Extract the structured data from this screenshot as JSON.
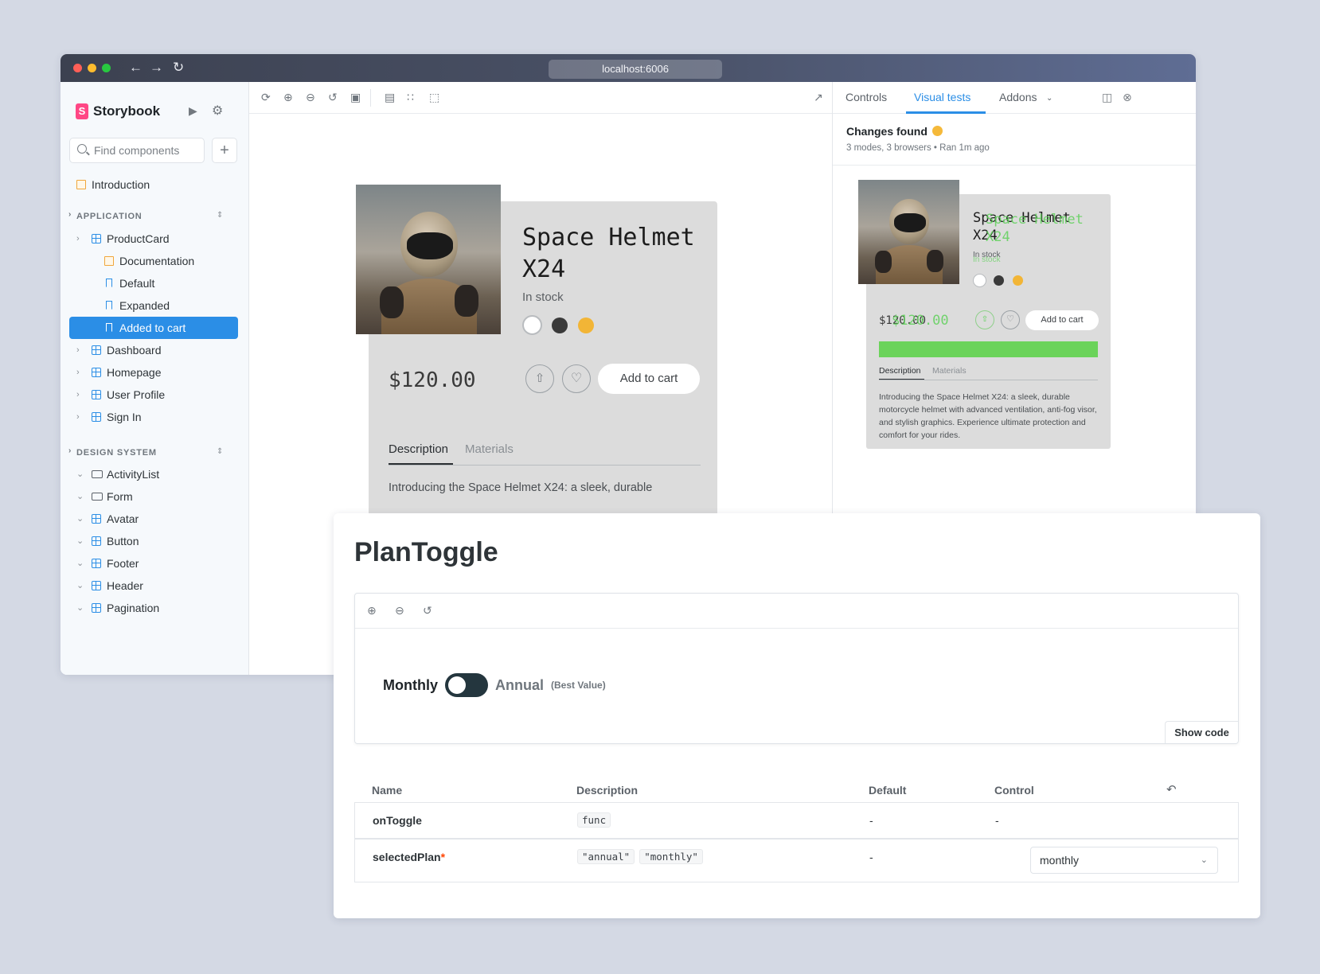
{
  "browser": {
    "url": "localhost:6006"
  },
  "sidebar": {
    "brand": "Storybook",
    "search_placeholder": "Find components",
    "intro": "Introduction",
    "sections": [
      {
        "label": "APPLICATION"
      },
      {
        "label": "DESIGN SYSTEM"
      }
    ],
    "app_items": [
      {
        "label": "ProductCard"
      },
      {
        "label": "Documentation"
      },
      {
        "label": "Default"
      },
      {
        "label": "Expanded"
      },
      {
        "label": "Added to cart"
      },
      {
        "label": "Dashboard"
      },
      {
        "label": "Homepage"
      },
      {
        "label": "User Profile"
      },
      {
        "label": "Sign In"
      }
    ],
    "ds_items": [
      {
        "label": "ActivityList"
      },
      {
        "label": "Form"
      },
      {
        "label": "Avatar"
      },
      {
        "label": "Button"
      },
      {
        "label": "Footer"
      },
      {
        "label": "Header"
      },
      {
        "label": "Pagination"
      }
    ]
  },
  "product": {
    "title_line1": "Space Helmet",
    "title_line2": "X24",
    "stock": "In stock",
    "price": "$120.00",
    "cart": "Add to cart",
    "tab_description": "Description",
    "tab_materials": "Materials",
    "description_short": "Introducing the Space Helmet X24: a sleek, durable",
    "description_full": "Introducing the Space Helmet X24: a sleek, durable motorcycle helmet with advanced ventilation, anti-fog visor, and stylish graphics. Experience ultimate protection and comfort for your rides.",
    "swatches": [
      "#ffffff",
      "#3a3a3a",
      "#f2b536"
    ]
  },
  "addons": {
    "tabs": [
      "Controls",
      "Visual tests",
      "Addons"
    ],
    "changes_title": "Changes found",
    "changes_meta": "3 modes, 3 browsers • Ran 1m ago"
  },
  "docs": {
    "title": "PlanToggle",
    "toggle": {
      "monthly": "Monthly",
      "annual": "Annual",
      "best": "(Best Value)"
    },
    "show_code": "Show code",
    "table": {
      "headers": [
        "Name",
        "Description",
        "Default",
        "Control"
      ],
      "rows": [
        {
          "name": "onToggle",
          "desc": [
            "func"
          ],
          "default": "-",
          "control": "-"
        },
        {
          "name": "selectedPlan",
          "required": "*",
          "desc": [
            "\"annual\"",
            "\"monthly\""
          ],
          "default": "-",
          "control": "monthly"
        }
      ]
    }
  }
}
